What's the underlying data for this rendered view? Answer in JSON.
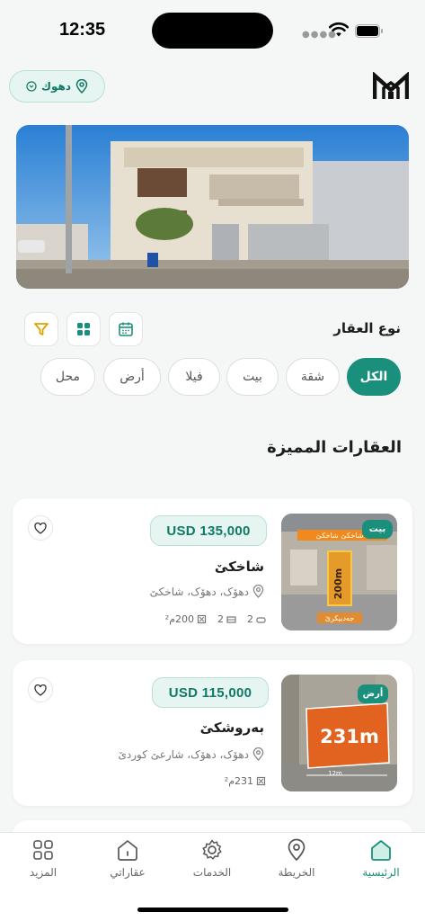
{
  "status": {
    "time": "12:35"
  },
  "header": {
    "location_label": "دهوك"
  },
  "filters": {
    "type_label": "نوع العقار",
    "chips": [
      "الكل",
      "شقة",
      "بيت",
      "فيلا",
      "أرض",
      "محل"
    ]
  },
  "featured": {
    "title": "العقارات المميزة",
    "cards": [
      {
        "badge": "بيت",
        "price": "USD 135,000",
        "title": "شاخكێ",
        "address": "دهۆک، دهۆک، شاخکێ",
        "features": {
          "bathrooms": "2",
          "bedrooms": "2",
          "area": "200م²"
        },
        "thumb_text": {
          "top": "شاخکێ شاخکێ",
          "side": "200m",
          "bottom": "جەدبیکرێ"
        }
      },
      {
        "badge": "أرض",
        "price": "USD 115,000",
        "title": "بەروشکێ",
        "address": "دهۆک، دهۆک، شارعێ کوردێ",
        "features": {
          "area": "231م²"
        },
        "thumb_text": {
          "main": "231m",
          "dim": "12m"
        }
      }
    ]
  },
  "nav": {
    "items": [
      {
        "label": "الرئيسية",
        "icon": "home-icon"
      },
      {
        "label": "الخريطة",
        "icon": "map-pin-icon"
      },
      {
        "label": "الخدمات",
        "icon": "gear-icon"
      },
      {
        "label": "عقاراتي",
        "icon": "house-icon"
      },
      {
        "label": "المزيد",
        "icon": "grid-icon"
      }
    ]
  },
  "colors": {
    "accent": "#1a8f7b",
    "accent_light": "#e6f5f1"
  }
}
